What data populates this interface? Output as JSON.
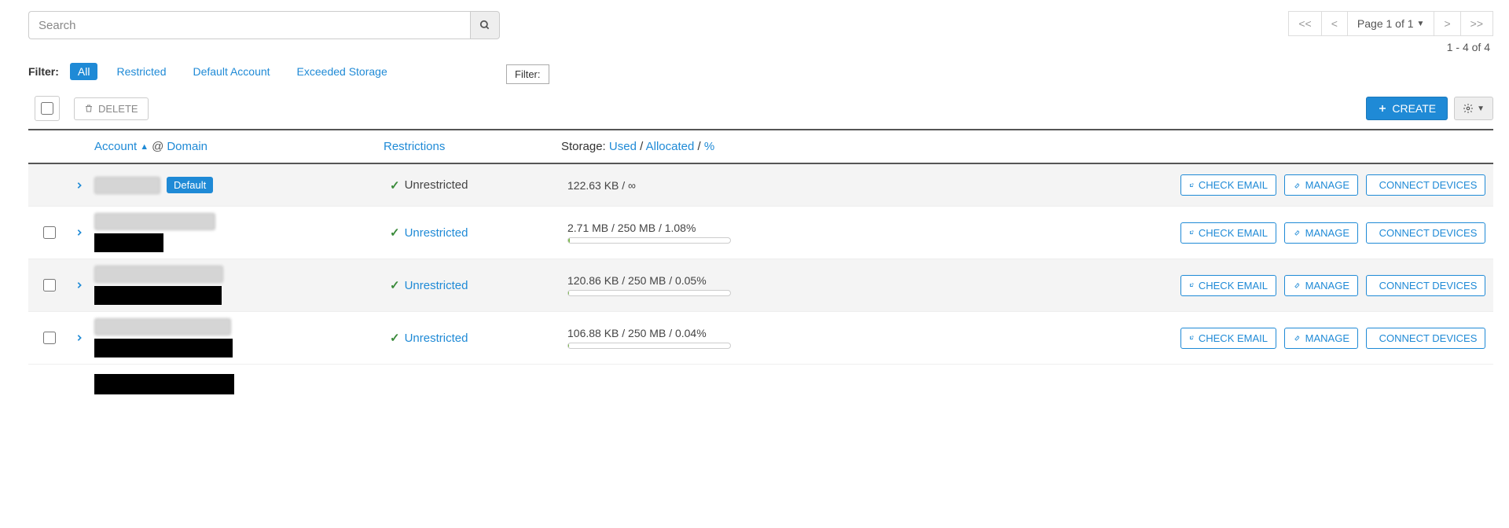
{
  "search": {
    "placeholder": "Search"
  },
  "pager": {
    "first": "<<",
    "prev": "<",
    "current": "Page 1 of 1",
    "next": ">",
    "last": ">>",
    "count_text": "1 - 4 of 4"
  },
  "filter": {
    "label": "Filter:",
    "tooltip": "Filter:",
    "options": {
      "all": "All",
      "restricted": "Restricted",
      "default_account": "Default Account",
      "exceeded_storage": "Exceeded Storage"
    },
    "active": "all"
  },
  "actions": {
    "delete": "DELETE",
    "create": "CREATE"
  },
  "headers": {
    "account_label": "Account",
    "domain_label": "Domain",
    "restrictions": "Restrictions",
    "storage_prefix": "Storage:",
    "storage_used": "Used",
    "storage_allocated": "Allocated",
    "storage_percent": "%"
  },
  "row_actions": {
    "check_email": "CHECK EMAIL",
    "manage": "MANAGE",
    "connect": "CONNECT DEVICES"
  },
  "badges": {
    "default": "Default"
  },
  "rows": [
    {
      "is_default": true,
      "has_checkbox": false,
      "restriction": "Unrestricted",
      "restriction_link": false,
      "storage_text": "122.63 KB / ∞",
      "has_bar": false,
      "bar_percent": 0
    },
    {
      "is_default": false,
      "has_checkbox": true,
      "restriction": "Unrestricted",
      "restriction_link": true,
      "storage_text": "2.71 MB / 250 MB / 1.08%",
      "has_bar": true,
      "bar_percent": 1.08
    },
    {
      "is_default": false,
      "has_checkbox": true,
      "restriction": "Unrestricted",
      "restriction_link": true,
      "storage_text": "120.86 KB / 250 MB / 0.05%",
      "has_bar": true,
      "bar_percent": 0.05
    },
    {
      "is_default": false,
      "has_checkbox": true,
      "restriction": "Unrestricted",
      "restriction_link": true,
      "storage_text": "106.88 KB / 250 MB / 0.04%",
      "has_bar": true,
      "bar_percent": 0.04
    }
  ]
}
